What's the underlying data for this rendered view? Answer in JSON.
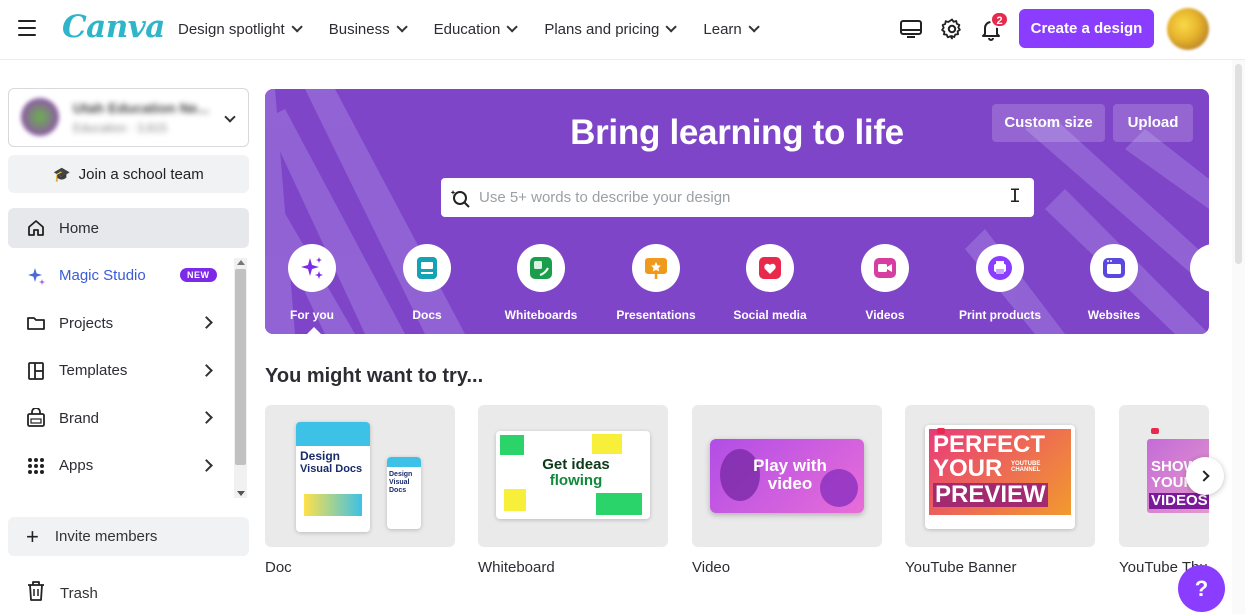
{
  "brand": {
    "logo_text": "Canva",
    "accent": "#8b3dff"
  },
  "nav": {
    "items": [
      "Design spotlight",
      "Business",
      "Education",
      "Plans and pricing",
      "Learn"
    ]
  },
  "header": {
    "notification_count": "2",
    "create_label": "Create a design"
  },
  "sidebar": {
    "team_name": "Utah Education Ne...",
    "team_sub": "Education · 3,815",
    "join_label": "Join a school team",
    "items": [
      {
        "label": "Home",
        "icon": "home-icon"
      },
      {
        "label": "Magic Studio",
        "icon": "sparkle-icon",
        "badge": "NEW"
      },
      {
        "label": "Projects",
        "icon": "folder-icon"
      },
      {
        "label": "Templates",
        "icon": "template-icon"
      },
      {
        "label": "Brand",
        "icon": "brand-icon"
      },
      {
        "label": "Apps",
        "icon": "apps-grid-icon"
      }
    ],
    "invite_label": "Invite members",
    "trash_label": "Trash"
  },
  "hero": {
    "title": "Bring learning to life",
    "custom_size_label": "Custom size",
    "upload_label": "Upload",
    "search_placeholder": "Use 5+ words to describe your design",
    "categories": [
      {
        "label": "For you",
        "color": "#7d2ae8"
      },
      {
        "label": "Docs",
        "color": "#13a3b5"
      },
      {
        "label": "Whiteboards",
        "color": "#1b9e4b"
      },
      {
        "label": "Presentations",
        "color": "#f09a1c"
      },
      {
        "label": "Social media",
        "color": "#e8294b"
      },
      {
        "label": "Videos",
        "color": "#d63ea0"
      },
      {
        "label": "Print products",
        "color": "#8b3dff"
      },
      {
        "label": "Websites",
        "color": "#5a48e0"
      }
    ]
  },
  "suggestions": {
    "title": "You might want to try...",
    "cards": [
      {
        "label": "Doc",
        "thumb_text_1": "Design",
        "thumb_text_2": "Visual Docs"
      },
      {
        "label": "Whiteboard",
        "thumb_text_1": "Get ideas",
        "thumb_text_2": "flowing"
      },
      {
        "label": "Video",
        "thumb_text_1": "Play with",
        "thumb_text_2": "video"
      },
      {
        "label": "YouTube Banner",
        "thumb_text_1": "PERFECT",
        "thumb_text_2": "YOUR",
        "thumb_text_3": "PREVIEW",
        "thumb_text_4": "YOUTUBE CHANNEL"
      },
      {
        "label": "YouTube Thu",
        "thumb_text_1": "SHOW",
        "thumb_text_2": "YOUR",
        "thumb_text_3": "VIDEOS"
      }
    ]
  },
  "help_label": "?"
}
